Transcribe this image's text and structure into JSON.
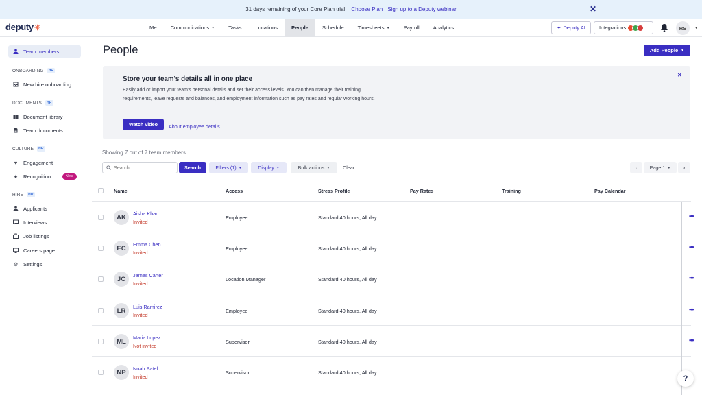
{
  "banner": {
    "message": "31 days remaining of your Core Plan trial.",
    "choose_plan": "Choose Plan",
    "webinar": "Sign up to a Deputy webinar"
  },
  "logo": "deputy",
  "nav": {
    "items": [
      "Me",
      "Communications",
      "Tasks",
      "Locations",
      "People",
      "Schedule",
      "Timesheets",
      "Payroll",
      "Analytics"
    ],
    "active": "People",
    "deputy_ai": "Deputy AI",
    "integrations": "Integrations",
    "user_initials": "RS"
  },
  "sidebar": {
    "team_members": "Team members",
    "onboarding_head": "ONBOARDING",
    "new_hire": "New hire onboarding",
    "documents_head": "DOCUMENTS",
    "doc_library": "Document library",
    "team_documents": "Team documents",
    "culture_head": "CULTURE",
    "engagement": "Engagement",
    "recognition": "Recognition",
    "new_badge": "New",
    "hire_head": "HIRE",
    "applicants": "Applicants",
    "interviews": "Interviews",
    "job_listings": "Job listings",
    "careers_page": "Careers page",
    "settings": "Settings",
    "hr_badge": "HR"
  },
  "main": {
    "title": "People",
    "add_people": "Add People",
    "promo": {
      "title": "Store your team's details all in one place",
      "body": "Easily add or import your team's personal details and set their access levels. You can then manage their training requirements, leave requests and balances, and employment information such as pay rates and regular working hours.",
      "watch_video": "Watch video",
      "about_link": "About employee details"
    },
    "showing": "Showing 7 out of 7 team members",
    "search_placeholder": "Search",
    "search_button": "Search",
    "filters": "Filters (1)",
    "display": "Display",
    "bulk_actions": "Bulk actions",
    "clear": "Clear",
    "page_label": "Page 1"
  },
  "table": {
    "columns": [
      "Name",
      "Access",
      "Stress Profile",
      "Pay Rates",
      "Training",
      "Pay Calendar"
    ],
    "rows": [
      {
        "initials": "AK",
        "name": "Aisha Khan",
        "status": "Invited",
        "access": "Employee",
        "stress": "Standard 40 hours, All day"
      },
      {
        "initials": "EC",
        "name": "Emma Chen",
        "status": "Invited",
        "access": "Employee",
        "stress": "Standard 40 hours, All day"
      },
      {
        "initials": "JC",
        "name": "James Carter",
        "status": "Invited",
        "access": "Location Manager",
        "stress": "Standard 40 hours, All day"
      },
      {
        "initials": "LR",
        "name": "Luis Ramirez",
        "status": "Invited",
        "access": "Employee",
        "stress": "Standard 40 hours, All day"
      },
      {
        "initials": "ML",
        "name": "Maria Lopez",
        "status": "Not invited",
        "access": "Supervisor",
        "stress": "Standard 40 hours, All day"
      },
      {
        "initials": "NP",
        "name": "Noah Patel",
        "status": "Invited",
        "access": "Supervisor",
        "stress": "Standard 40 hours, All day"
      }
    ]
  },
  "colors": {
    "accent": "#3a2ec2",
    "banner_bg": "#e6f1fb",
    "status_red": "#c43a2a",
    "new_badge": "#c2187e"
  },
  "help_label": "?"
}
